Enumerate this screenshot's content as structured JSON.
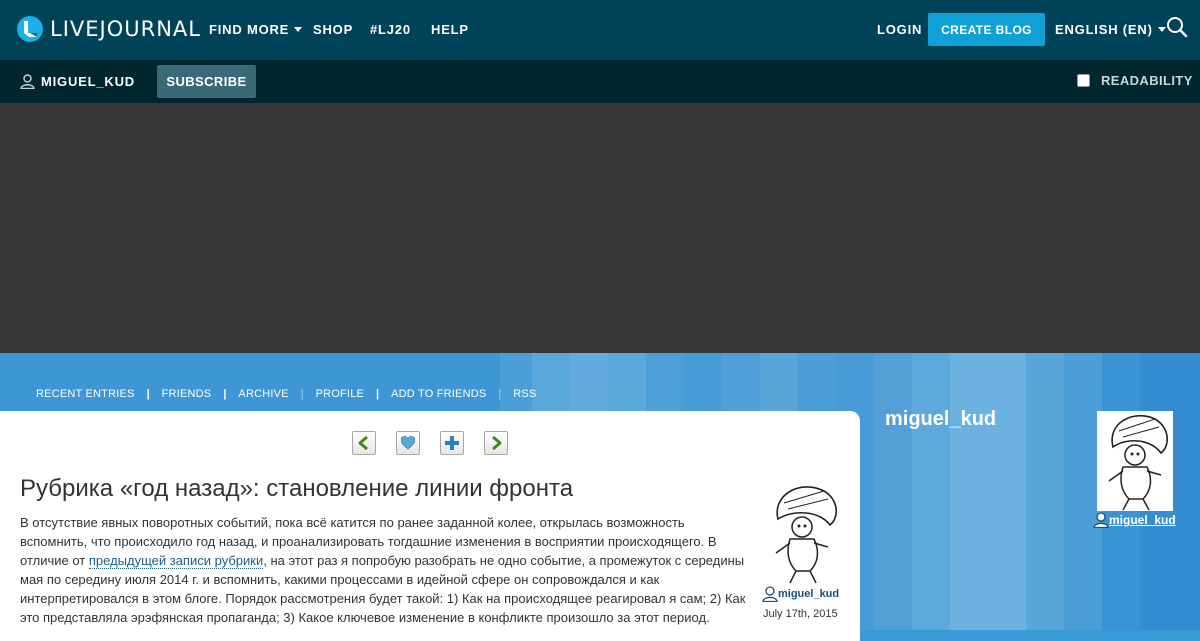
{
  "header": {
    "logo_text": "LIVEJOURNAL",
    "nav": [
      {
        "label": "FIND MORE",
        "has_dropdown": true
      },
      {
        "label": "SHOP"
      },
      {
        "label": "#LJ20"
      },
      {
        "label": "HELP"
      }
    ],
    "login_label": "LOGIN",
    "create_blog_label": "CREATE BLOG",
    "language_label": "ENGLISH (EN)",
    "colors": {
      "bar": "#004359",
      "accent": "#0fa0d6"
    }
  },
  "journal_bar": {
    "username": "MIGUEL_KUD",
    "subscribe_label": "SUBSCRIBE",
    "readability_label": "READABILITY",
    "readability_checked": false
  },
  "journal_tabs": [
    "RECENT ENTRIES",
    "FRIENDS",
    "ARCHIVE",
    "PROFILE",
    "ADD TO FRIENDS",
    "RSS"
  ],
  "entry": {
    "toolbar_icons": [
      "previous-arrow-icon",
      "heart-icon",
      "plus-icon",
      "next-arrow-icon"
    ],
    "title": "Рубрика «год назад»: становление линии фронта",
    "body_part1": "В отсутствие явных поворотных событий, пока всё катится по ранее заданной колее, открылась возможность вспомнить, что происходило год назад, и проанализировать тогдашние изменения в восприятии происходящего. В отличие от ",
    "body_link": "предыдущей записи рубрики",
    "body_part2": ", на этот раз я попробую разобрать не одно событие, а промежуток с середины мая по середину июля 2014 г. и вспомнить, какими процессами в идейной сфере он сопровождался и как интерпретировался в этом блоге. Порядок рассмотрения будет такой: 1) Как на происходящее реагировал я сам; 2) Как это представляла эрэфянская пропаганда; 3) Какое ключевое изменение в конфликте произошло за этот период.",
    "author": "miguel_kud",
    "date": "July 17th, 2015"
  },
  "sidebar": {
    "journal_name": "miguel_kud",
    "username": "miguel_kud"
  }
}
